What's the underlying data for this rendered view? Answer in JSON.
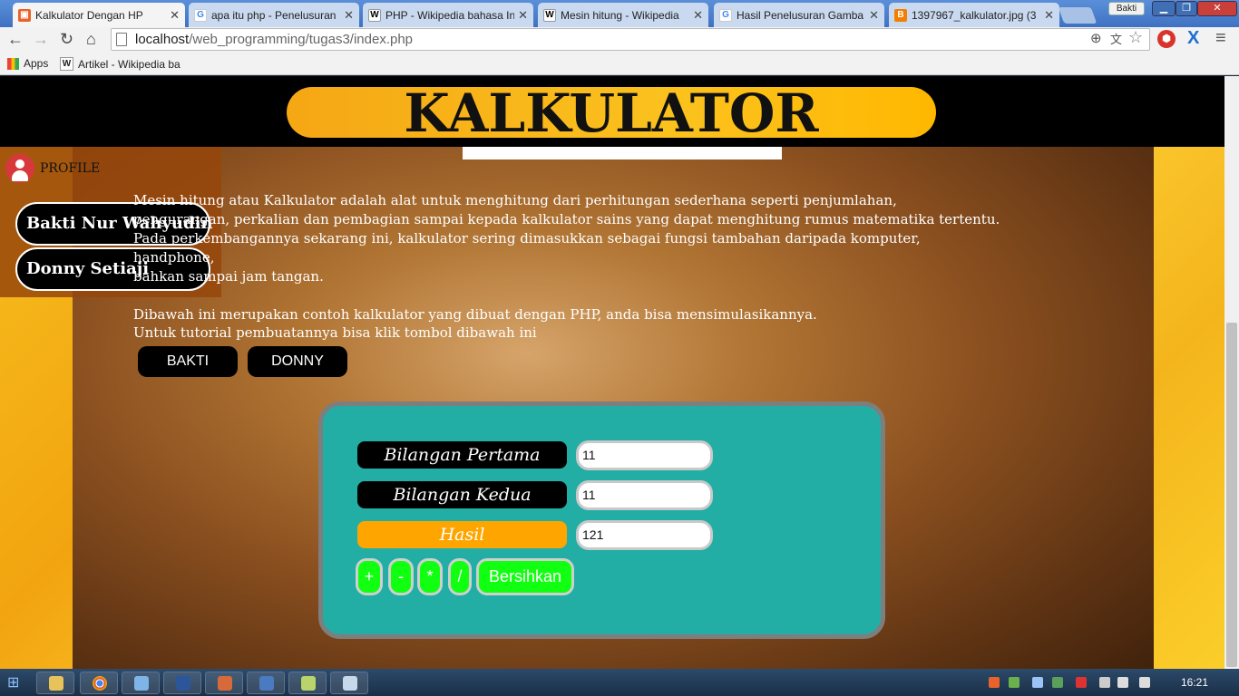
{
  "browser": {
    "tabs": [
      {
        "title": "Kalkulator Dengan HP",
        "favicon": "calc-favicon",
        "active": true
      },
      {
        "title": "apa itu php - Penelusuran",
        "favicon": "google-favicon"
      },
      {
        "title": "PHP - Wikipedia bahasa In",
        "favicon": "wikipedia-favicon"
      },
      {
        "title": "Mesin hitung - Wikipedia",
        "favicon": "wikipedia-favicon"
      },
      {
        "title": "Hasil Penelusuran Gamba",
        "favicon": "google-favicon"
      },
      {
        "title": "1397967_kalkulator.jpg (3",
        "favicon": "blogger-favicon"
      }
    ],
    "user_badge": "Bakti",
    "url_host": "localhost",
    "url_path": "/web_programming/tugas3/index.php",
    "bookmarks": [
      {
        "label": "Apps",
        "icon": "apps-grid-icon"
      },
      {
        "label": "Artikel - Wikipedia ba",
        "icon": "wikipedia-icon"
      }
    ]
  },
  "page": {
    "title": "KALKULATOR",
    "profile_label": "PROFILE",
    "profiles": [
      "Bakti Nur Wahyudin",
      "Donny Setiaji"
    ],
    "intro_lines": [
      "Mesin hitung atau Kalkulator adalah alat untuk menghitung dari perhitungan sederhana seperti penjumlahan,",
      "pengurangan, perkalian dan pembagian sampai kepada kalkulator sains yang dapat menghitung rumus matematika tertentu.",
      "Pada perkembangannya sekarang ini, kalkulator sering dimasukkan sebagai fungsi tambahan daripada komputer, handphone,",
      "bahkan sampai jam tangan."
    ],
    "intro2_lines": [
      "Dibawah ini merupakan contoh kalkulator yang dibuat dengan PHP, anda bisa mensimulasikannya.",
      "Untuk tutorial pembuatannya bisa klik tombol dibawah ini"
    ],
    "tutorial_buttons": [
      "BAKTI",
      "DONNY"
    ]
  },
  "calculator": {
    "label_first": "Bilangan Pertama",
    "label_second": "Bilangan Kedua",
    "label_result": "Hasil",
    "value_first": "11",
    "value_second": "11",
    "value_result": "121",
    "ops": [
      "+",
      "-",
      "*",
      "/"
    ],
    "clear_label": "Bersihkan"
  },
  "taskbar": {
    "clock": "16:21"
  },
  "colors": {
    "header_bg": "#000000",
    "title_pill": "#f5a714",
    "calc_bg": "#22aea5",
    "result_label": "#ffa500",
    "op_button": "#11ff11"
  }
}
